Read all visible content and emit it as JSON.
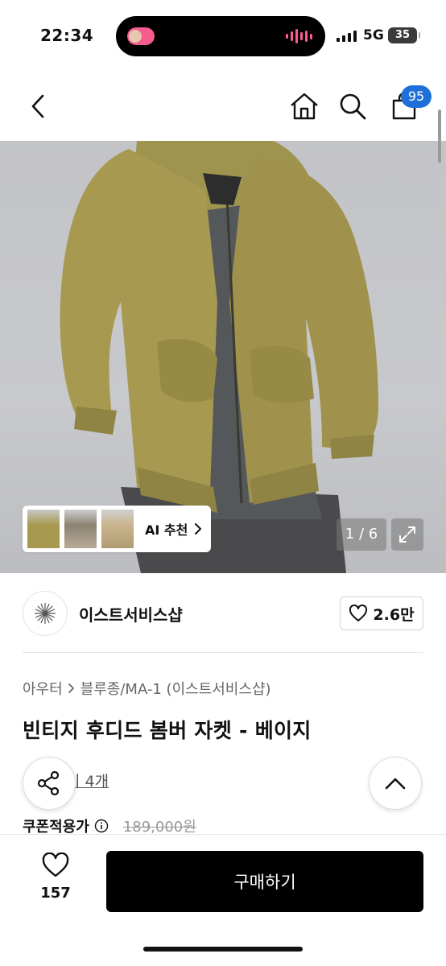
{
  "status_bar": {
    "time": "22:34",
    "network": "5G",
    "battery": "35"
  },
  "header": {
    "back_icon": "chevron-left-icon",
    "home_icon": "home-icon",
    "search_icon": "search-icon",
    "cart_icon": "shopping-bag-icon",
    "cart_badge": "95",
    "badge_color": "#1f6fd8"
  },
  "gallery": {
    "ai_recommend_label": "AI 추천",
    "counter": "1 / 6",
    "expand_icon": "expand-icon"
  },
  "store": {
    "name": "이스트서비스샵",
    "likes": "2.6만"
  },
  "product": {
    "breadcrumb_category": "아우터",
    "breadcrumb_sub": "블루종/MA-1 (이스트서비스샵)",
    "title": "빈티지 후디드 봄버 자켓 - 베이지",
    "review_link": "기 4개",
    "coupon_price_label": "쿠폰적용가",
    "original_price": "189,000원"
  },
  "bottom_bar": {
    "wish_count": "157",
    "buy_label": "구매하기"
  }
}
